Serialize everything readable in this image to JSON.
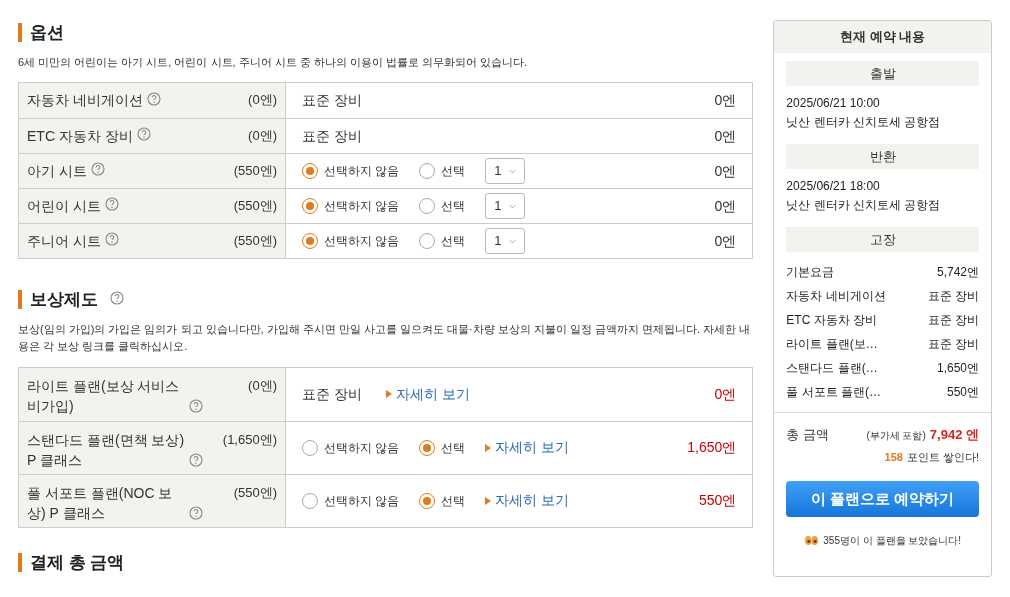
{
  "options": {
    "title": "옵션",
    "note": "6세 미만의 어린이는 아기 시트, 어린이 시트, 주니어 시트 중 하나의 이용이 법률로 의무화되어 있습니다.",
    "rows": [
      {
        "kind": "standard",
        "name": "자동차 네비게이션",
        "price": "(0엔)",
        "value": "표준 장비",
        "amount": "0엔"
      },
      {
        "kind": "standard",
        "name": "ETC 자동차 장비",
        "price": "(0엔)",
        "value": "표준 장비",
        "amount": "0엔"
      },
      {
        "kind": "choice",
        "name": "아기 시트",
        "price": "(550엔)",
        "radios": [
          {
            "label": "선택하지 않음",
            "selected": true
          },
          {
            "label": "선택",
            "selected": false
          }
        ],
        "quantity": "1",
        "amount": "0엔"
      },
      {
        "kind": "choice",
        "name": "어린이 시트",
        "price": "(550엔)",
        "radios": [
          {
            "label": "선택하지 않음",
            "selected": true
          },
          {
            "label": "선택",
            "selected": false
          }
        ],
        "quantity": "1",
        "amount": "0엔"
      },
      {
        "kind": "choice",
        "name": "주니어 시트",
        "price": "(550엔)",
        "radios": [
          {
            "label": "선택하지 않음",
            "selected": true
          },
          {
            "label": "선택",
            "selected": false
          }
        ],
        "quantity": "1",
        "amount": "0엔"
      }
    ]
  },
  "insurance": {
    "title": "보상제도",
    "note": "보상(임의 가입)의 가입은 임의가 되고 있습니다만, 가입해 주시면 만일 사고를 일으켜도 대물·차량 보상의 지불이 일정 금액까지 면제됩니다. 자세한 내용은 각 보상 링크를 클릭하십시오.",
    "rows": [
      {
        "kind": "standard",
        "name": "라이트 플랜(보상 서비스 비가입)",
        "price": "(0엔)",
        "value": "표준 장비",
        "link": "자세히 보기",
        "amount": "0엔"
      },
      {
        "kind": "choice",
        "name": "스탠다드 플랜(면책 보상) P 클래스",
        "price": "(1,650엔)",
        "radios": [
          {
            "label": "선택하지 않음",
            "selected": false
          },
          {
            "label": "선택",
            "selected": true
          }
        ],
        "link": "자세히 보기",
        "amount": "1,650엔"
      },
      {
        "kind": "choice",
        "name": "풀 서포트 플랜(NOC 보상) P 클래스",
        "price": "(550엔)",
        "radios": [
          {
            "label": "선택하지 않음",
            "selected": false
          },
          {
            "label": "선택",
            "selected": true
          }
        ],
        "link": "자세히 보기",
        "amount": "550엔"
      }
    ]
  },
  "payment": {
    "title": "결제 총 금액"
  },
  "summary": {
    "title": "현재 예약 내용",
    "departure": {
      "heading": "출발",
      "datetime": "2025/06/21 10:00",
      "location": "닛산 렌터카 신치토세 공항점"
    },
    "return": {
      "heading": "반환",
      "datetime": "2025/06/21 18:00",
      "location": "닛산 렌터카 신치토세 공항점"
    },
    "breakdown": {
      "heading": "고장",
      "items": [
        {
          "label": "기본요금",
          "value": "5,742엔"
        },
        {
          "label": "자동차 네비게이션",
          "value": "표준 장비"
        },
        {
          "label": "ETC 자동차 장비",
          "value": "표준 장비"
        },
        {
          "label": "라이트 플랜(보…",
          "value": "표준 장비"
        },
        {
          "label": "스탠다드 플랜(…",
          "value": "1,650엔"
        },
        {
          "label": "풀 서포트 플랜(…",
          "value": "550엔"
        }
      ]
    },
    "total_label": "총 금액",
    "tax_note": "(부가세 포함)",
    "total": "7,942 엔",
    "points": "158",
    "points_text": "포인트 쌓인다!",
    "button": "이 플랜으로 예약하기",
    "viewers": "355명이 이 플랜을 보았습니다!"
  }
}
